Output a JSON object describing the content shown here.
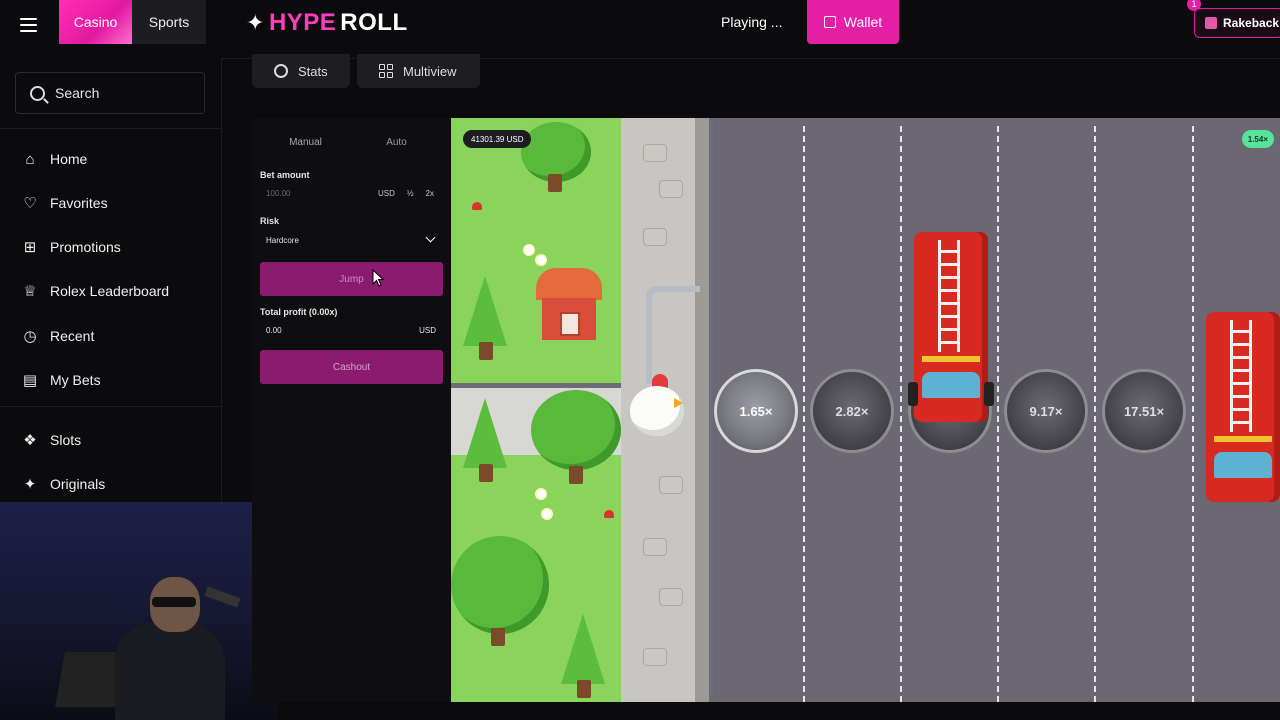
{
  "header": {
    "menu_icon": "hamburger-icon",
    "tabs": [
      {
        "label": "Casino",
        "active": true
      },
      {
        "label": "Sports",
        "active": false
      }
    ],
    "logo": {
      "star": "✦",
      "brand_part1": "HYPE",
      "brand_part2": "ROLL"
    },
    "status": "Playing ...",
    "wallet_label": "Wallet",
    "rakeback_label": "Rakeback",
    "rakeback_badge": "1",
    "accent": "#e51ea6"
  },
  "sidebar": {
    "search_placeholder": "Search",
    "items": [
      {
        "label": "Home",
        "icon": "home-icon"
      },
      {
        "label": "Favorites",
        "icon": "heart-icon"
      },
      {
        "label": "Promotions",
        "icon": "gift-icon"
      },
      {
        "label": "Rolex Leaderboard",
        "icon": "trophy-icon"
      },
      {
        "label": "Recent",
        "icon": "clock-icon"
      },
      {
        "label": "My Bets",
        "icon": "receipt-icon"
      },
      {
        "label": "Slots",
        "icon": "slots-icon"
      },
      {
        "label": "Originals",
        "icon": "sparkle-icon"
      }
    ]
  },
  "subtabs": {
    "stats_label": "Stats",
    "multiview_label": "Multiview"
  },
  "bet_panel": {
    "modes": [
      "Manual",
      "Auto"
    ],
    "active_mode": "Manual",
    "bet_amount_label": "Bet amount",
    "bet_amount_value": "100.00",
    "bet_currency": "USD",
    "half_label": "½",
    "double_label": "2x",
    "risk_label": "Risk",
    "risk_value": "Hardcore",
    "jump_label": "Jump",
    "total_profit_label": "Total profit (0.00x)",
    "total_profit_value": "0.00",
    "profit_currency": "USD",
    "cashout_label": "Cashout"
  },
  "game": {
    "balance": "41301.39 USD",
    "next_multiplier": "1.54×",
    "multipliers": [
      "1.65×",
      "2.82×",
      "9.17×",
      "17.51×"
    ]
  }
}
